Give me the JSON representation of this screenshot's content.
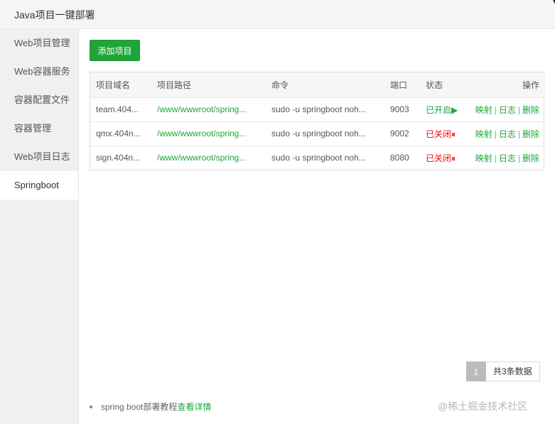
{
  "window": {
    "title": "Java项目一键部署",
    "close_glyph": "✕"
  },
  "sidebar": {
    "items": [
      {
        "label": "Web项目管理"
      },
      {
        "label": "Web容器服务"
      },
      {
        "label": "容器配置文件"
      },
      {
        "label": "容器管理"
      },
      {
        "label": "Web项目日志"
      },
      {
        "label": "Springboot",
        "active": true
      }
    ]
  },
  "main": {
    "add_button": "添加项目",
    "table": {
      "headers": [
        "项目域名",
        "项目路径",
        "命令",
        "端口",
        "状态",
        "操作"
      ],
      "rows": [
        {
          "domain": "team.404...",
          "path": "/www/wwwroot/spring...",
          "command": "sudo -u springboot noh...",
          "port": "9003",
          "status": "已开启▶",
          "status_state": "on"
        },
        {
          "domain": "qmx.404n...",
          "path": "/www/wwwroot/spring...",
          "command": "sudo -u springboot noh...",
          "port": "9002",
          "status": "已关闭⏸",
          "status_state": "off"
        },
        {
          "domain": "sign.404n...",
          "path": "/www/wwwroot/spring...",
          "command": "sudo -u springboot noh...",
          "port": "8080",
          "status": "已关闭⏸",
          "status_state": "off"
        }
      ],
      "actions": {
        "map": "映射",
        "log": "日志",
        "delete": "删除",
        "separator": "|"
      }
    },
    "pagination": {
      "current_page": "1",
      "total_text": "共3条数据"
    },
    "tips": {
      "text": "spring boot部署教程",
      "link": "查看详情"
    }
  },
  "colors": {
    "accent": "#20a53a",
    "danger": "#ef0808"
  },
  "watermark": "@稀土掘金技术社区"
}
